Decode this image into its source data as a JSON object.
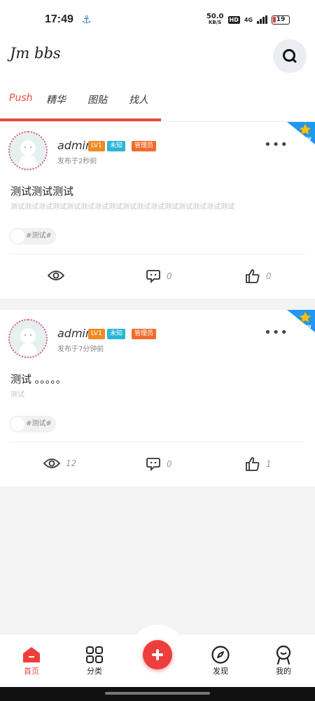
{
  "status": {
    "time": "17:49",
    "speed": "50.0",
    "speed_unit": "KB/S",
    "hd": "HD",
    "net": "4G",
    "battery": "19"
  },
  "header": {
    "title": "Jm bbs"
  },
  "tabs": [
    {
      "label": "Push"
    },
    {
      "label": "精华"
    },
    {
      "label": "图贴"
    },
    {
      "label": "找人"
    }
  ],
  "posts": [
    {
      "author": "admin",
      "level": "LV1",
      "title_badge": "未知",
      "role_badge": "管理员",
      "time": "发布于2秒前",
      "title": "测试测试测试",
      "body": "测试测试测试测试测试测试测试测试测试测试测试测试测试测试测试测试",
      "tag": "#测试#",
      "views": "",
      "comments": "0",
      "likes": "0"
    },
    {
      "author": "admin",
      "level": "LV1",
      "title_badge": "未知",
      "role_badge": "管理员",
      "time": "发布于7分钟前",
      "title": "测试 。。。。。",
      "body": "测试",
      "tag": "#测试#",
      "views": "12",
      "comments": "0",
      "likes": "1"
    }
  ],
  "nav": {
    "home": "首页",
    "category": "分类",
    "discover": "发现",
    "mine": "我的"
  },
  "colors": {
    "accent": "#e94a3a",
    "fab": "#ee3e3c"
  }
}
